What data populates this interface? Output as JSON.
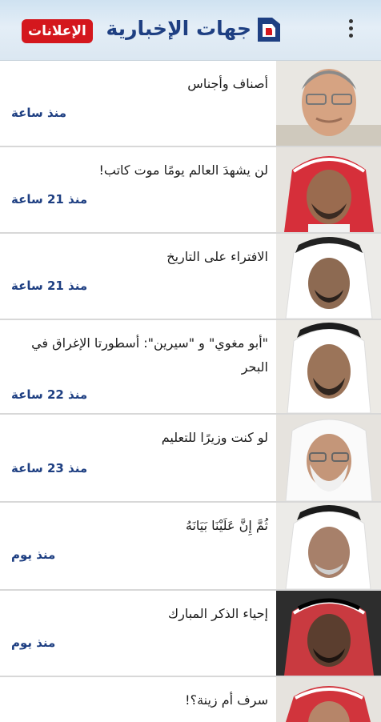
{
  "header": {
    "brand_title": "جهات الإخبارية",
    "ads_label": "الإعلانات",
    "menu_icon": "more-vert-icon",
    "logo_icon": "brand-logo-icon"
  },
  "articles": [
    {
      "title": "أصناف وأجناس",
      "time": "منذ ساعة"
    },
    {
      "title": "لن يشهدَ العالم يومًا موت كاتب!",
      "time": "منذ 21 ساعة"
    },
    {
      "title": "الافتراء على التاريخ",
      "time": "منذ 21 ساعة"
    },
    {
      "title": "\"أبو مغوي\" و \"سيرين\": أسطورتا الإغراق في البحر",
      "time": "منذ 22 ساعة"
    },
    {
      "title": "لو كنت وزيرًا للتعليم",
      "time": "منذ 23 ساعة"
    },
    {
      "title": "ثُمَّ إِنَّ عَلَيْنَا بَيَانَهُ",
      "time": "منذ يوم"
    },
    {
      "title": "إحياء الذكر المبارك",
      "time": "منذ يوم"
    },
    {
      "title": "سرف أم زينة؟!",
      "time": ""
    }
  ],
  "colors": {
    "brand_blue": "#1e3f82",
    "brand_red": "#d4171d"
  }
}
